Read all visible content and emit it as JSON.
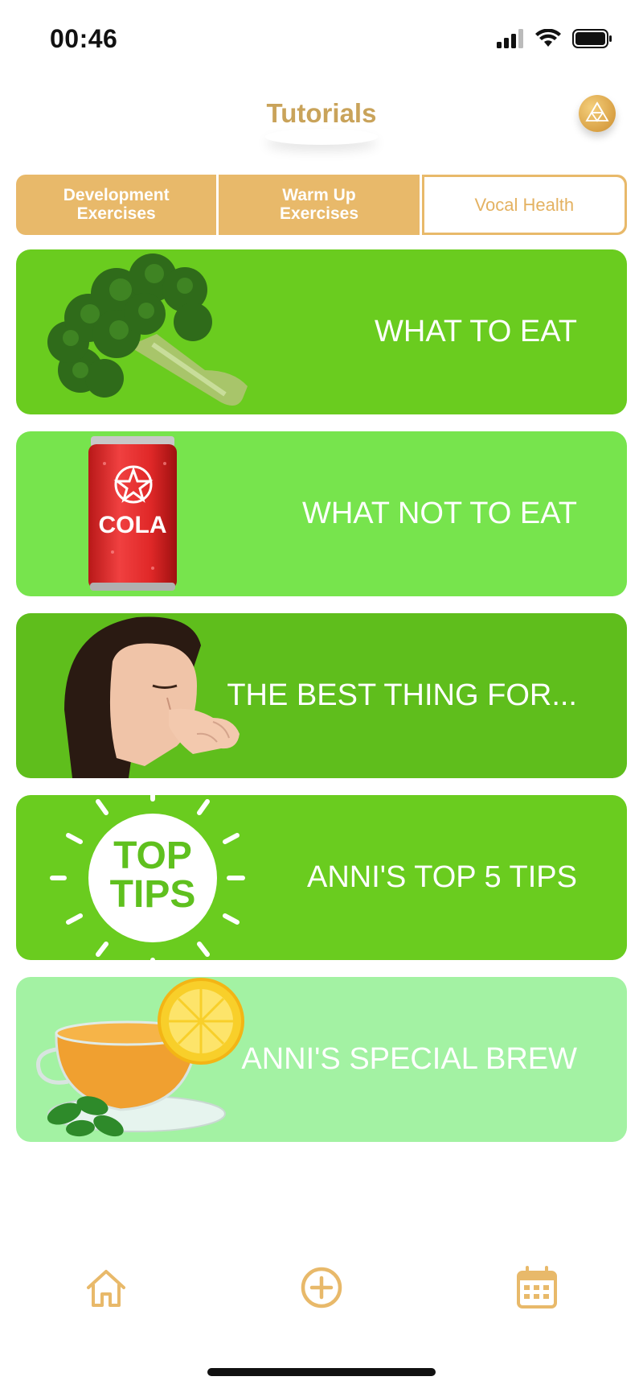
{
  "status_bar": {
    "time": "00:46"
  },
  "header": {
    "title": "Tutorials"
  },
  "tabs": [
    {
      "label": "Development\nExercises",
      "selected": false
    },
    {
      "label": "Warm Up\nExercises",
      "selected": false
    },
    {
      "label": "Vocal Health",
      "selected": true
    }
  ],
  "cards": [
    {
      "title": "WHAT TO EAT",
      "color": "#6acc1f",
      "art": "broccoli-image"
    },
    {
      "title": "WHAT NOT TO EAT",
      "color": "#77e44d",
      "art": "cola-can-image"
    },
    {
      "title": "THE BEST THING FOR...",
      "color": "#5fbe1c",
      "art": "woman-coughing-image"
    },
    {
      "title": "ANNI'S TOP 5 TIPS",
      "color": "#6acc1f",
      "art": "top-tips-sun-image",
      "art_text": "TOP TIPS"
    },
    {
      "title": "ANNI'S SPECIAL BREW",
      "color": "#a3f2a3",
      "art": "tea-cup-image"
    }
  ],
  "cola_label": "COLA",
  "top_tips": {
    "line1": "TOP",
    "line2": "TIPS"
  },
  "bottom_nav": [
    "home-icon",
    "add-icon",
    "calendar-icon"
  ],
  "colors": {
    "accent": "#e8b96a",
    "title": "#c9a35a"
  }
}
